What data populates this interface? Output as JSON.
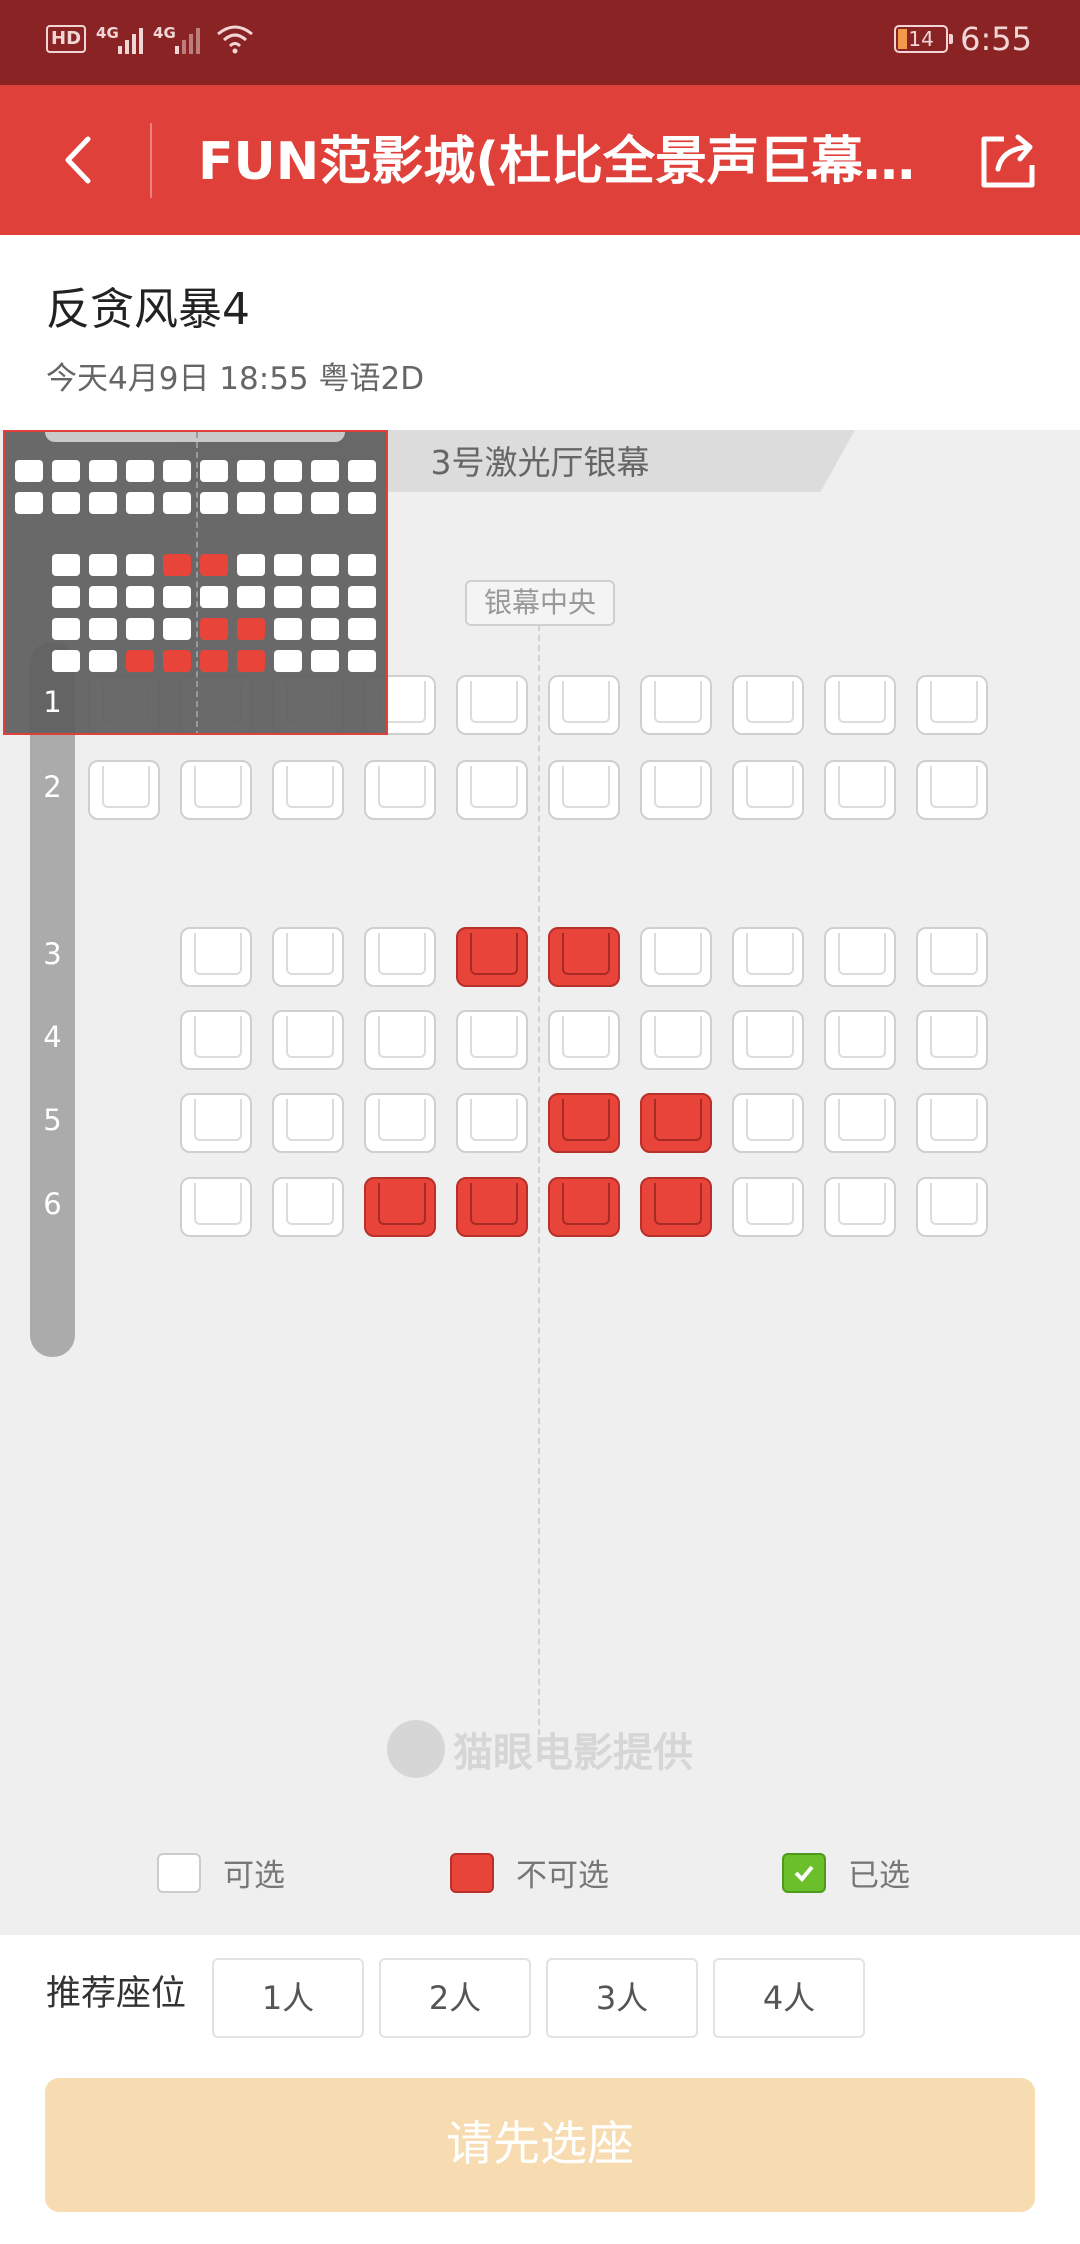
{
  "status_bar": {
    "hd": "HD",
    "net1": "4G",
    "net2": "4G",
    "battery": "14",
    "time": "6:55"
  },
  "header": {
    "title": "FUN范影城(杜比全景声巨幕…"
  },
  "movie": {
    "title": "反贪风暴4",
    "meta": "今天4月9日  18:55  粤语2D"
  },
  "seatmap": {
    "screen_label": "3号激光厅银幕",
    "center_label": "银幕中央",
    "rows": [
      {
        "label": "1",
        "seats": [
          0,
          0,
          0,
          0,
          0,
          0,
          0,
          0,
          0,
          0
        ]
      },
      {
        "label": "2",
        "seats": [
          0,
          0,
          0,
          0,
          0,
          0,
          0,
          0,
          0,
          0
        ]
      },
      {
        "label": "3",
        "seats": [
          0,
          0,
          0,
          1,
          1,
          0,
          0,
          0,
          0
        ]
      },
      {
        "label": "4",
        "seats": [
          0,
          0,
          0,
          0,
          0,
          0,
          0,
          0,
          0
        ]
      },
      {
        "label": "5",
        "seats": [
          0,
          0,
          0,
          0,
          1,
          1,
          0,
          0,
          0
        ]
      },
      {
        "label": "6",
        "seats": [
          0,
          0,
          1,
          1,
          1,
          1,
          0,
          0,
          0
        ]
      }
    ]
  },
  "watermark": "猫眼电影提供",
  "legend": {
    "available": "可选",
    "unavailable": "不可选",
    "selected": "已选"
  },
  "recommend": {
    "label": "推荐座位",
    "options": [
      "1人",
      "2人",
      "3人",
      "4人"
    ]
  },
  "cta": "请先选座"
}
